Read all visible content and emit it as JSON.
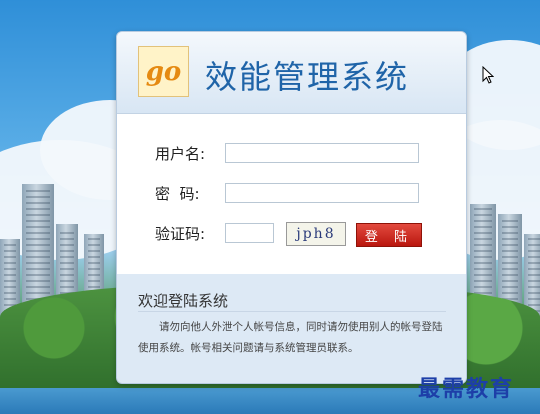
{
  "app": {
    "title": "效能管理系统",
    "logo_text": "go"
  },
  "form": {
    "username_label": "用户名:",
    "password_label": "密  码:",
    "captcha_label": "验证码:",
    "captcha_text": "jph8",
    "login_button": "登 陆"
  },
  "welcome": {
    "title": "欢迎登陆系统",
    "notice": "请勿向他人外泄个人帐号信息，同时请勿使用别人的帐号登陆使用系统。帐号相关问题请与系统管理员联系。"
  },
  "watermark": "最需教育",
  "colors": {
    "title": "#1f64a8",
    "login_button": "#c8221a",
    "background": "#58ace6"
  }
}
